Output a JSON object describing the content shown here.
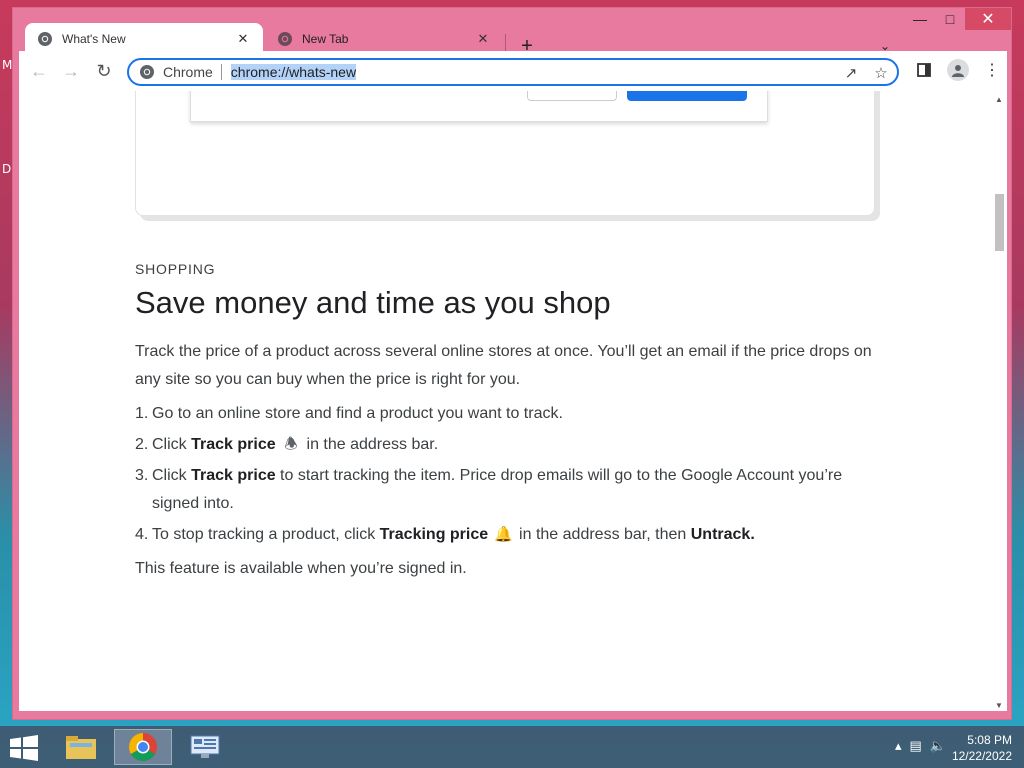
{
  "desktop": {
    "edge_letters": [
      "M",
      "D"
    ]
  },
  "browser": {
    "tabs": [
      {
        "title": "What's New"
      },
      {
        "title": "New Tab"
      }
    ],
    "omnibox": {
      "chip": "Chrome",
      "url": "chrome://whats-new"
    }
  },
  "article": {
    "eyebrow": "SHOPPING",
    "headline": "Save money and time as you shop",
    "intro": "Track the price of a product across several online stores at once. You’ll get an email if the price drops on any site so you can buy when the price is right for you.",
    "steps": [
      {
        "num": "1.",
        "text": "Go to an online store and find a product you want to track."
      },
      {
        "num": "2.",
        "pre": "Click ",
        "bold": "Track price",
        "post": " in the address bar."
      },
      {
        "num": "3.",
        "pre": "Click ",
        "bold": "Track price",
        "post": " to start tracking the item. Price drop emails will go to the Google Account you’re signed into."
      },
      {
        "num": "4.",
        "pre": "To stop tracking a product, click ",
        "bold": "Tracking price",
        "mid": " in the address bar, then ",
        "bold2": "Untrack."
      }
    ],
    "note": "This feature is available when you’re signed in."
  },
  "taskbar": {
    "time": "5:08 PM",
    "date": "12/22/2022"
  }
}
